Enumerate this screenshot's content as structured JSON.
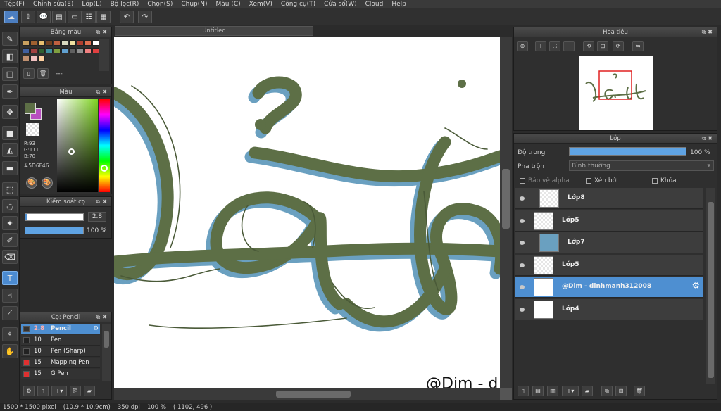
{
  "menu": [
    "Tệp(F)",
    "Chỉnh sửa(E)",
    "Lớp(L)",
    "Bộ lọc(R)",
    "Chọn(S)",
    "Chụp(N)",
    "Màu (C)",
    "Xem(V)",
    "Công cụ(T)",
    "Cửa sổ(W)",
    "Cloud",
    "Help"
  ],
  "canvas": {
    "tab_title": "Untitled",
    "watermark": "@Dim - d"
  },
  "panels": {
    "palette": {
      "title": "Bảng màu",
      "footer_text": "---"
    },
    "color": {
      "title": "Màu",
      "r": "R:93",
      "g": "G:111",
      "b": "B:70",
      "hex": "#5D6F46",
      "current_color": "#5d6f46",
      "secondary_color": "#b84fc0"
    },
    "brush_control": {
      "title": "Kiểm soát cọ",
      "size": "2.8",
      "opacity": "100 %",
      "opacity_fraction": 1.0
    },
    "brush": {
      "title": "Cọ: Pencil",
      "items": [
        {
          "size": "2.8",
          "name": "Pencil",
          "color": "#333333",
          "selected": true
        },
        {
          "size": "10",
          "name": "Pen",
          "color": "#222222",
          "selected": false
        },
        {
          "size": "10",
          "name": "Pen (Sharp)",
          "color": "#222222",
          "selected": false
        },
        {
          "size": "15",
          "name": "Mapping Pen",
          "color": "#e03030",
          "selected": false
        },
        {
          "size": "15",
          "name": "G Pen",
          "color": "#e03030",
          "selected": false
        }
      ]
    },
    "navigator": {
      "title": "Hoa tiêu"
    },
    "layers": {
      "title": "Lớp",
      "opacity_label": "Độ trong",
      "opacity_value": "100 %",
      "opacity_fraction": 1.0,
      "blend_label": "Pha trộn",
      "blend_value": "Bình thường",
      "protect_alpha": "Bảo vệ alpha",
      "clipping": "Xén bớt",
      "lock": "Khóa",
      "items": [
        {
          "name": "Lớp8",
          "selected": false,
          "folder": false
        },
        {
          "name": "Lớp5",
          "selected": false,
          "folder": false
        },
        {
          "name": "Lớp7",
          "selected": false,
          "folder": false
        },
        {
          "name": "Lớp5",
          "selected": false,
          "folder": false
        },
        {
          "name": "@Dim - dinhmanh312008",
          "selected": true,
          "folder": false
        },
        {
          "name": "Lớp4",
          "selected": false,
          "folder": false
        }
      ]
    }
  },
  "status": {
    "size": "1500 * 1500 pixel",
    "physical": "(10.9 * 10.9cm)",
    "dpi": "350 dpi",
    "zoom": "100 %",
    "cursor": "( 1102, 496 )"
  },
  "colors": {
    "accent": "#4e8fd1",
    "stroke_green": "#5d6f46",
    "stroke_blue": "#6aa0c0"
  }
}
